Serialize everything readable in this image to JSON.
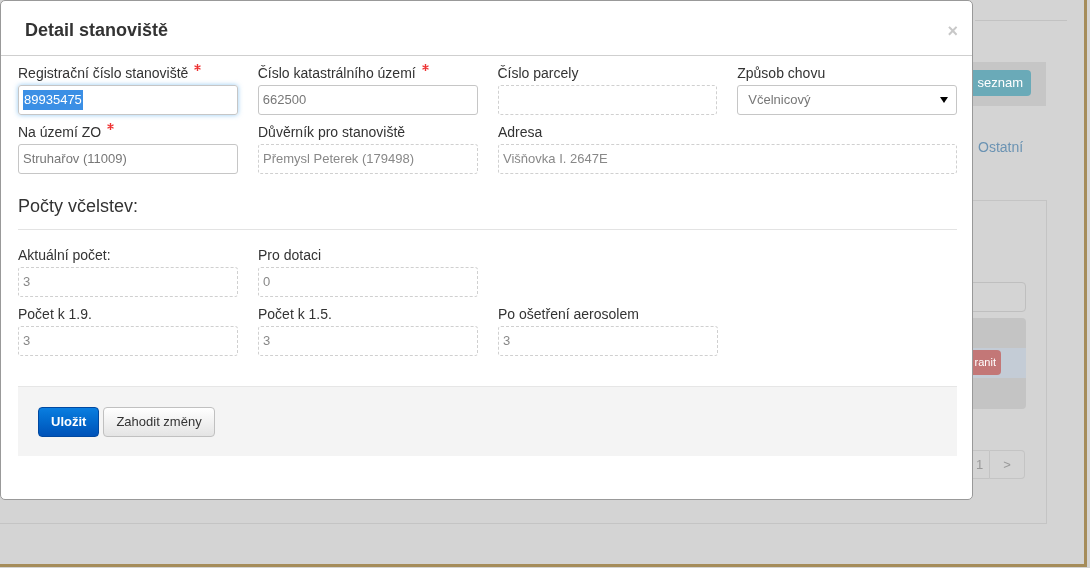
{
  "background": {
    "list_button": "seznam",
    "link": "Ostatní",
    "delete_button": "ranit",
    "pagination": [
      "1",
      ">"
    ]
  },
  "dialog": {
    "title": "Detail stanoviště",
    "close": "×"
  },
  "rows": [
    [
      {
        "label": "Registrační číslo stanoviště",
        "required": true,
        "kind": "text",
        "value": "89935475",
        "readonly": false,
        "focused": true
      },
      {
        "label": "Číslo katastrálního území",
        "required": true,
        "kind": "text",
        "value": "662500",
        "readonly": false,
        "focused": false
      },
      {
        "label": "Číslo parcely",
        "required": false,
        "kind": "text",
        "readonly": true,
        "focused": false
      },
      {
        "label": "Způsob chovu",
        "required": false,
        "kind": "select",
        "value": "Včelnicový",
        "readonly": false,
        "focused": false
      }
    ],
    [
      {
        "label": "Na území ZO",
        "required": true,
        "kind": "text",
        "value": "Struhařov (11009)",
        "readonly": false,
        "focused": false
      },
      {
        "label": "Důvěrník pro stanoviště",
        "required": false,
        "kind": "text",
        "value": "Přemysl Peterek (179498)",
        "readonly": true,
        "focused": false
      },
      {
        "label": "Adresa",
        "required": false,
        "kind": "text",
        "value": "Višňovka I. 2647E",
        "readonly": true,
        "focused": false
      }
    ]
  ],
  "section": {
    "title": "Počty včelstev:",
    "rows": [
      [
        {
          "label": "Aktuální počet:",
          "value": "3",
          "readonly": true
        },
        {
          "label": "Pro dotaci",
          "value": "0",
          "readonly": true
        }
      ],
      [
        {
          "label": "Počet k 1.9.",
          "value": "3",
          "readonly": true
        },
        {
          "label": "Počet k 1.5.",
          "value": "3",
          "readonly": true
        },
        {
          "label": "Po ošetření aerosolem",
          "value": "3",
          "readonly": true
        }
      ]
    ]
  },
  "buttons": [
    {
      "label": "Uložit",
      "kind": "primary"
    },
    {
      "label": "Zahodit změny",
      "kind": "default"
    }
  ]
}
